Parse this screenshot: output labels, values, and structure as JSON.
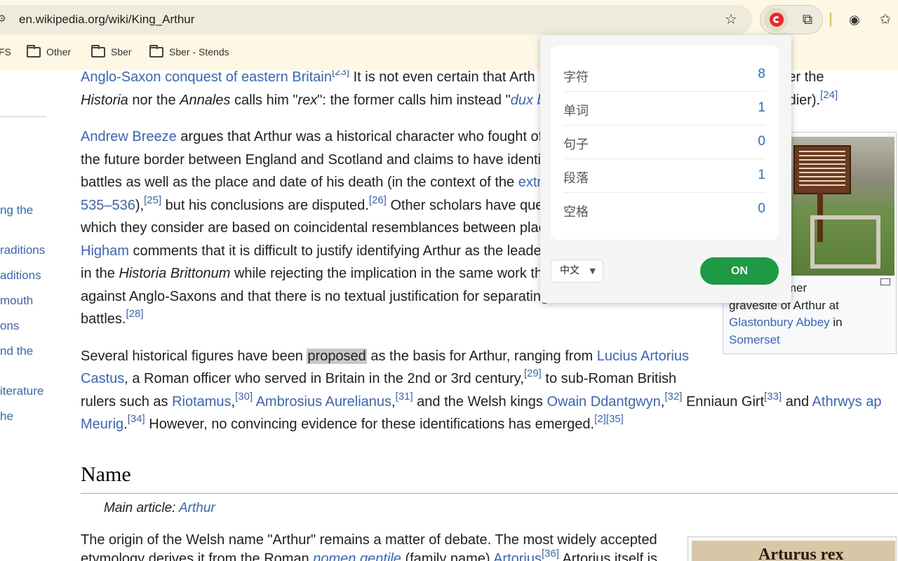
{
  "browser": {
    "url": "en.wikipedia.org/wiki/King_Arthur",
    "bookmarks": [
      {
        "label": "FS"
      },
      {
        "label": "Other"
      },
      {
        "label": "Sber"
      },
      {
        "label": "Sber - Stends"
      }
    ]
  },
  "toc": {
    "items": [
      "ng the",
      "raditions",
      "aditions",
      "mouth",
      "ons",
      "nd the",
      "iterature",
      "he"
    ]
  },
  "article": {
    "p1": {
      "l1_link": "Anglo-Saxon conquest of eastern Britain",
      "l1_sup": "[23]",
      "l1_text": " It is not even certain that Arth",
      "l1_tail": "ts. Neither the",
      "l2_a": "Historia",
      "l2_b": " nor the ",
      "l2_c": "Annales",
      "l2_d": " calls him \"",
      "l2_e": "rex",
      "l2_f": "\": the former calls him instead \"",
      "l2_g": "dux b",
      "l2_tail": "oldier).",
      "l2_sup": "[24]"
    },
    "p2": {
      "l1_link": "Andrew Breeze",
      "l1_text": " argues that Arthur was a historical character who fought of",
      "l2": "the future border between England and Scotland and claims to have identi",
      "l3_text": "battles as well as the place and date of his death (in the context of the ",
      "l3_link": "extr",
      "l4_link": "535–536",
      "l4_a": "),",
      "l4_sup1": "[25]",
      "l4_b": " but his conclusions are disputed.",
      "l4_sup2": "[26]",
      "l4_c": " Other scholars have que",
      "l5": "which they consider are based on coincidental resemblances between plac",
      "l6_link": "Higham",
      "l6_text": " comments that it is difficult to justify identifying Arthur as the leade",
      "l7_a": "in the ",
      "l7_b": "Historia Brittonum",
      "l7_c": " while rejecting the implication in the same work th",
      "l8": "against Anglo-Saxons and that there is no textual justification for separating",
      "l9_text": "battles.",
      "l9_sup": "[28]"
    },
    "p3": {
      "l1_a": "Several historical figures have been ",
      "l1_hl": "proposed",
      "l1_b": " as the basis for Arthur, ranging from ",
      "l1_link": "Lucius Artorius",
      "l2_link": "Castus",
      "l2_a": ", a Roman officer who served in Britain in the 2nd or 3rd century,",
      "l2_sup": "[29]",
      "l2_b": " to sub-Roman British",
      "l3_a": "rulers such as ",
      "l3_link1": "Riotamus",
      "l3_b": ",",
      "l3_sup1": "[30]",
      "l3_link2": "Ambrosius Aurelianus",
      "l3_c": ",",
      "l3_sup2": "[31]",
      "l3_d": " and the Welsh kings ",
      "l3_link3": "Owain Ddantgwyn",
      "l3_e": ",",
      "l3_sup3": "[32]",
      "l3_f": " Enniaun Girt",
      "l3_sup4": "[33]",
      "l3_g": " and ",
      "l3_link4": "Athrwys ap",
      "l4_link": "Meurig",
      "l4_a": ".",
      "l4_sup1": "[34]",
      "l4_b": " However, no convincing evidence for these identifications has emerged.",
      "l4_sup2": "[2][35]"
    },
    "section_name": "Name",
    "main_article_prefix": "Main article: ",
    "main_article_link": "Arthur",
    "p4": {
      "l1": "The origin of the Welsh name \"Arthur\" remains a matter of debate. The most widely accepted",
      "l2_a": "etymology derives it from the Roman ",
      "l2_link1": "nomen gentile",
      "l2_b": " (family name) ",
      "l2_link2": "Artorius",
      "l2_sup": "[36]",
      "l2_c": " Artorius itself is"
    }
  },
  "thumbnail": {
    "caption_a": "former",
    "caption_b": "gravesite of Arthur at",
    "caption_link1": "Glastonbury Abbey",
    "caption_c": " in",
    "caption_link2": "Somerset"
  },
  "thumbnail2": {
    "text": "Arturus rex"
  },
  "popup": {
    "stats": [
      {
        "label": "字符",
        "value": "8"
      },
      {
        "label": "单词",
        "value": "1"
      },
      {
        "label": "句子",
        "value": "0"
      },
      {
        "label": "段落",
        "value": "1"
      },
      {
        "label": "空格",
        "value": "0"
      }
    ],
    "language": "中文",
    "toggle_label": "ON",
    "accent_color": "#1a73e8",
    "toggle_color": "#1e9a44"
  }
}
